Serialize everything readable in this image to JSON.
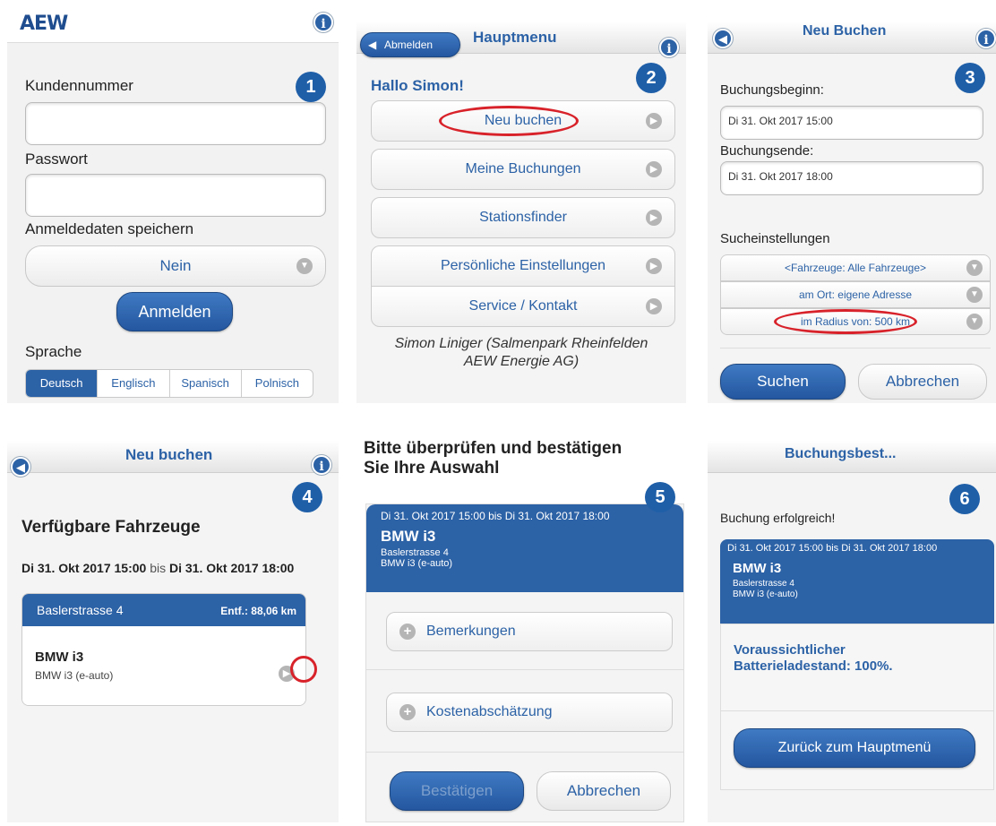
{
  "screen1": {
    "logo": "AEW",
    "step": "1",
    "info_icon": "info-icon",
    "kundennummer_label": "Kundennummer",
    "kundennummer_value": "",
    "passwort_label": "Passwort",
    "passwort_value": "",
    "speichern_label": "Anmeldedaten speichern",
    "speichern_value": "Nein",
    "login_button": "Anmelden",
    "sprache_label": "Sprache",
    "languages": [
      "Deutsch",
      "Englisch",
      "Spanisch",
      "Polnisch"
    ]
  },
  "screen2": {
    "back_button": "Abmelden",
    "title": "Hauptmenu",
    "step": "2",
    "greeting": "Hallo Simon!",
    "menu": [
      "Neu buchen",
      "Meine Buchungen",
      "Stationsfinder",
      "Persönliche Einstellungen",
      "Service / Kontakt"
    ],
    "footer_line1": "Simon Liniger (Salmenpark Rheinfelden",
    "footer_line2": "AEW Energie AG)"
  },
  "screen3": {
    "title": "Neu Buchen",
    "step": "3",
    "beginn_label": "Buchungsbeginn:",
    "beginn_value": "Di 31. Okt 2017 15:00",
    "ende_label": "Buchungsende:",
    "ende_value": "Di 31. Okt 2017 18:00",
    "such_label": "Sucheinstellungen",
    "options": [
      "<Fahrzeuge: Alle Fahrzeuge>",
      "am Ort: eigene Adresse",
      "im Radius von: 500 km"
    ],
    "search_button": "Suchen",
    "cancel_button": "Abbrechen"
  },
  "screen4": {
    "title": "Neu buchen",
    "step": "4",
    "heading": "Verfügbare Fahrzeuge",
    "date_from": "Di 31. Okt 2017 15:00",
    "date_sep": "bis",
    "date_to": "Di 31. Okt 2017 18:00",
    "station": "Baslerstrasse 4",
    "distance": "Entf.: 88,06 km",
    "car_name": "BMW i3",
    "car_desc": "BMW i3 (e-auto)"
  },
  "screen5": {
    "heading_line1": "Bitte überprüfen und bestätigen",
    "heading_line2": "Sie Ihre Auswahl",
    "step": "5",
    "period": "Di 31. Okt 2017 15:00 bis Di 31. Okt 2017 18:00",
    "car_name": "BMW i3",
    "address": "Baslerstrasse 4",
    "car_desc": "BMW i3 (e-auto)",
    "bemerkungen": "Bemerkungen",
    "kosten": "Kostenabschätzung",
    "confirm_button": "Bestätigen",
    "cancel_button": "Abbrechen"
  },
  "screen6": {
    "title": "Buchungsbest...",
    "step": "6",
    "success": "Buchung erfolgreich!",
    "period": "Di 31. Okt 2017 15:00 bis Di 31. Okt 2017 18:00",
    "car_name": "BMW i3",
    "address": "Baslerstrasse 4",
    "car_desc": "BMW i3 (e-auto)",
    "battery_line1": "Voraussichtlicher",
    "battery_line2": "Batterieladestand: 100%.",
    "back_button": "Zurück zum Hauptmenü"
  },
  "colors": {
    "accent": "#2c62a6",
    "highlight": "#d8222a"
  }
}
